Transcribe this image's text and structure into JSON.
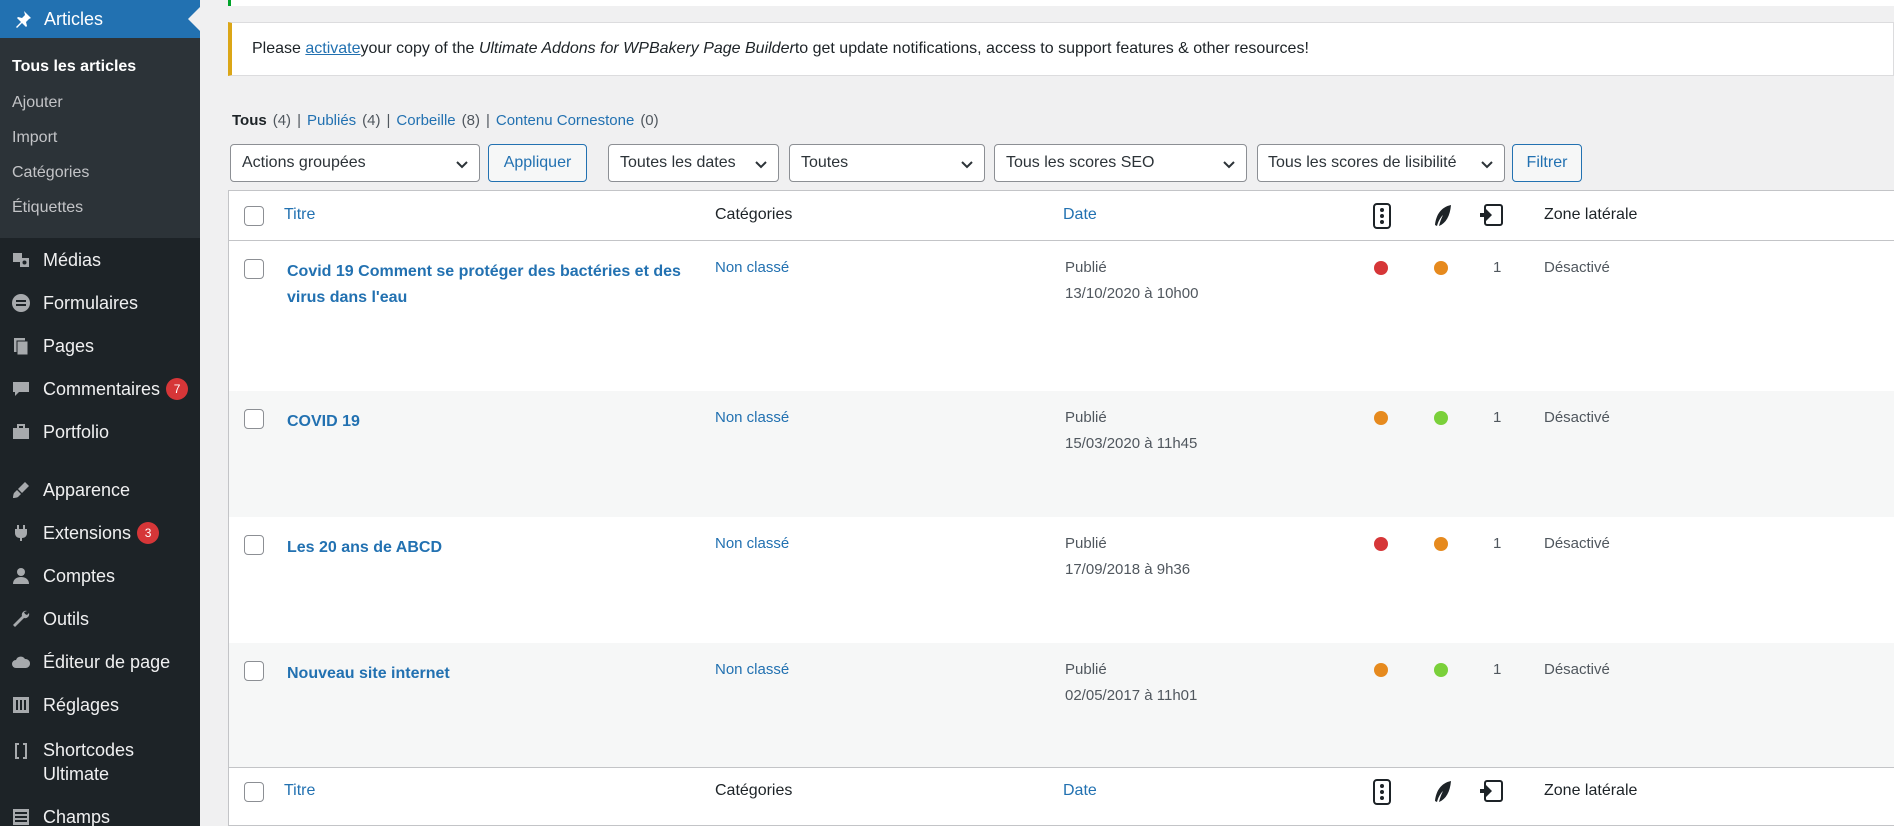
{
  "sidebar": {
    "active": {
      "label": "Articles",
      "icon": "pin-icon"
    },
    "submenu": [
      "Tous les articles",
      "Ajouter",
      "Import",
      "Catégories",
      "Étiquettes"
    ],
    "items": [
      {
        "label": "Médias",
        "icon": "media-icon",
        "badge": ""
      },
      {
        "label": "Formulaires",
        "icon": "forms-icon",
        "badge": ""
      },
      {
        "label": "Pages",
        "icon": "pages-icon",
        "badge": ""
      },
      {
        "label": "Commentaires",
        "icon": "comments-icon",
        "badge": "7"
      },
      {
        "label": "Portfolio",
        "icon": "portfolio-icon",
        "badge": ""
      },
      {
        "label": "Apparence",
        "icon": "brush-icon",
        "badge": ""
      },
      {
        "label": "Extensions",
        "icon": "plugin-icon",
        "badge": "3"
      },
      {
        "label": "Comptes",
        "icon": "users-icon",
        "badge": ""
      },
      {
        "label": "Outils",
        "icon": "wrench-icon",
        "badge": ""
      },
      {
        "label": "Éditeur de page",
        "icon": "cloud-icon",
        "badge": ""
      },
      {
        "label": "Réglages",
        "icon": "settings-icon",
        "badge": ""
      },
      {
        "label": "Shortcodes Ultimate",
        "line1": "Shortcodes",
        "line2": "Ultimate",
        "icon": "brackets-icon",
        "badge": ""
      },
      {
        "label": "Champs",
        "icon": "fields-icon",
        "badge": ""
      }
    ]
  },
  "notice": {
    "before": "Please ",
    "link": "activate",
    "middle": " your copy of the ",
    "product": "Ultimate Addons for WPBakery Page Builder",
    "after": " to get update notifications, access to support features & other resources!"
  },
  "views": [
    {
      "label": "Tous",
      "count": "(4)",
      "current": true
    },
    {
      "label": "Publiés",
      "count": "(4)",
      "current": false
    },
    {
      "label": "Corbeille",
      "count": "(8)",
      "current": false
    },
    {
      "label": "Contenu Cornestone",
      "count": "(0)",
      "current": false
    }
  ],
  "filters": {
    "bulk_actions": "Actions groupées",
    "apply": "Appliquer",
    "dates": "Toutes les dates",
    "categories": "Toutes",
    "seo": "Tous les scores SEO",
    "readability": "Tous les scores de lisibilité",
    "filter": "Filtrer"
  },
  "table": {
    "columns": {
      "title": "Titre",
      "categories": "Catégories",
      "date": "Date",
      "seo_icon": "seo-score-icon",
      "readability_icon": "readability-feather-icon",
      "links_icon": "internal-links-icon",
      "zone": "Zone latérale"
    },
    "rows": [
      {
        "title": "Covid 19 Comment se protéger des bactéries et des virus dans l'eau",
        "category": "Non classé",
        "status": "Publié",
        "date": "13/10/2020 à 10h00",
        "seo": "#d63638",
        "readability": "#e68a1e",
        "links": "1",
        "zone": "Désactivé"
      },
      {
        "title": "COVID 19",
        "category": "Non classé",
        "status": "Publié",
        "date": "15/03/2020 à 11h45",
        "seo": "#e68a1e",
        "readability": "#7ad03a",
        "links": "1",
        "zone": "Désactivé"
      },
      {
        "title": "Les 20 ans de ABCD",
        "category": "Non classé",
        "status": "Publié",
        "date": "17/09/2018 à 9h36",
        "seo": "#d63638",
        "readability": "#e68a1e",
        "links": "1",
        "zone": "Désactivé"
      },
      {
        "title": "Nouveau site internet",
        "category": "Non classé",
        "status": "Publié",
        "date": "02/05/2017 à 11h01",
        "seo": "#e68a1e",
        "readability": "#7ad03a",
        "links": "1",
        "zone": "Désactivé"
      }
    ]
  }
}
